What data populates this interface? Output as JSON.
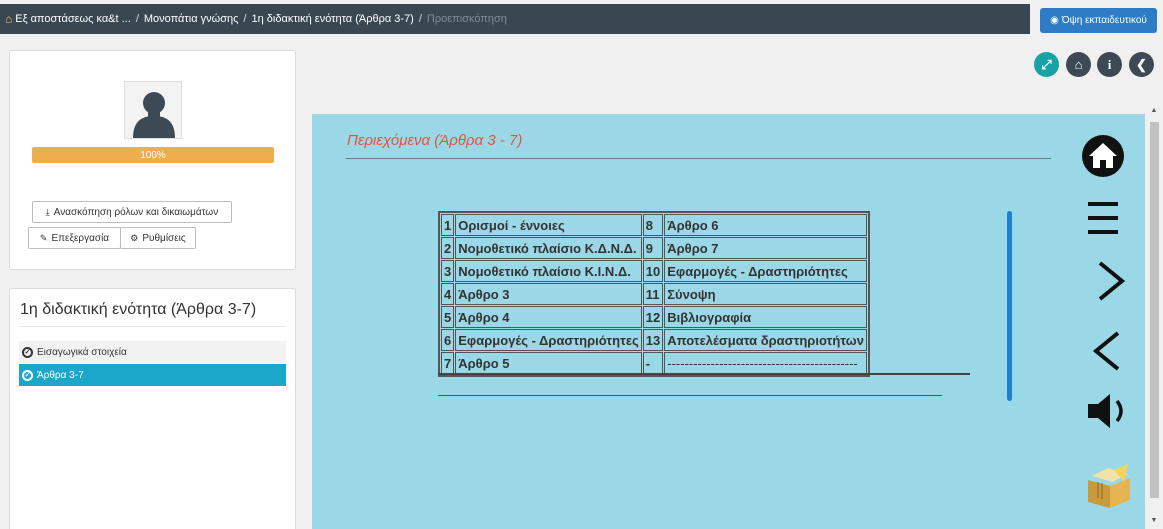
{
  "breadcrumb": {
    "home_icon": "home-icon",
    "items": [
      "Εξ αποστάσεως κα&t ...",
      "Μονοπάτια γνώσης",
      "1η διδακτική ενότητα (Άρθρα 3-7)"
    ],
    "current": "Προεπισκόπηση",
    "separator": "/"
  },
  "teacher_view": {
    "label": "Όψη εκπαιδευτικού",
    "icon": "eye-icon"
  },
  "profile": {
    "progress_label": "100%",
    "progress_value": 100,
    "roles_button": "Ανασκόπηση ρόλων και δικαιωμάτων",
    "edit_button": "Επεξεργασία",
    "settings_button": "Ρυθμίσεις"
  },
  "unit": {
    "title": "1η διδακτική ενότητα (Άρθρα 3-7)",
    "items": [
      "Εισαγωγικά στοιχεία",
      "Άρθρα 3-7"
    ]
  },
  "top_actions": [
    "expand-icon",
    "home-icon",
    "info-icon",
    "back-icon"
  ],
  "content": {
    "title": "Περιεχόμενα (Άρθρα 3 - 7)",
    "rows": [
      [
        "1",
        "Ορισμοί - έννοιες",
        "8",
        "Άρθρο 6"
      ],
      [
        "2",
        "Νομοθετικό πλαίσιο Κ.Δ.Ν.Δ.",
        "9",
        "Άρθρο 7"
      ],
      [
        "3",
        "Νομοθετικό πλαίσιο Κ.Ι.Ν.Δ.",
        "10",
        "Εφαρμογές - Δραστηριότητες"
      ],
      [
        "4",
        "Άρθρο 3",
        "11",
        "Σύνοψη"
      ],
      [
        "5",
        "Άρθρο 4",
        "12",
        "Βιβλιογραφία"
      ],
      [
        "6",
        "Εφαρμογές - Δραστηριότητες",
        "13",
        "Αποτελέσματα δραστηριοτήτων"
      ],
      [
        "7",
        "Άρθρο 5",
        "-",
        "--------------------------------------------"
      ]
    ]
  },
  "side_nav": [
    "home-icon",
    "menu-icon",
    "next-icon",
    "previous-icon",
    "sound-icon",
    "glossary-book-icon"
  ],
  "colors": {
    "breadcrumb_bg": "#3a4752",
    "teacher_button": "#2e7cc5",
    "progress": "#f0ad4e",
    "active_item": "#1aa7c9",
    "stage_bg": "#9ad8e8",
    "title_red": "#e5533a"
  }
}
